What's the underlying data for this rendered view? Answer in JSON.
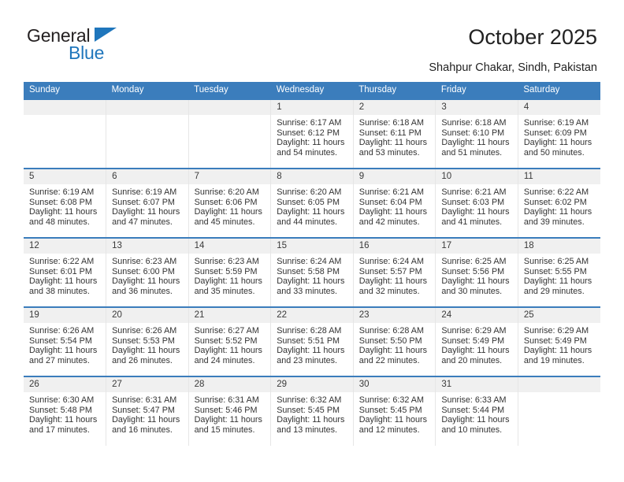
{
  "brand": {
    "name_top": "General",
    "name_bottom": "Blue",
    "accent_color": "#1f76bc"
  },
  "header": {
    "title": "October 2025",
    "subtitle": "Shahpur Chakar, Sindh, Pakistan",
    "header_bg_color": "#3b7dbc"
  },
  "calendar": {
    "weekday_headers": [
      "Sunday",
      "Monday",
      "Tuesday",
      "Wednesday",
      "Thursday",
      "Friday",
      "Saturday"
    ],
    "labels": {
      "sunrise": "Sunrise:",
      "sunset": "Sunset:",
      "daylight": "Daylight:"
    },
    "weeks": [
      [
        {
          "day": "",
          "sunrise": "",
          "sunset": "",
          "daylight_line1": "",
          "daylight_line2": ""
        },
        {
          "day": "",
          "sunrise": "",
          "sunset": "",
          "daylight_line1": "",
          "daylight_line2": ""
        },
        {
          "day": "",
          "sunrise": "",
          "sunset": "",
          "daylight_line1": "",
          "daylight_line2": ""
        },
        {
          "day": "1",
          "sunrise": "Sunrise: 6:17 AM",
          "sunset": "Sunset: 6:12 PM",
          "daylight_line1": "Daylight: 11 hours",
          "daylight_line2": "and 54 minutes."
        },
        {
          "day": "2",
          "sunrise": "Sunrise: 6:18 AM",
          "sunset": "Sunset: 6:11 PM",
          "daylight_line1": "Daylight: 11 hours",
          "daylight_line2": "and 53 minutes."
        },
        {
          "day": "3",
          "sunrise": "Sunrise: 6:18 AM",
          "sunset": "Sunset: 6:10 PM",
          "daylight_line1": "Daylight: 11 hours",
          "daylight_line2": "and 51 minutes."
        },
        {
          "day": "4",
          "sunrise": "Sunrise: 6:19 AM",
          "sunset": "Sunset: 6:09 PM",
          "daylight_line1": "Daylight: 11 hours",
          "daylight_line2": "and 50 minutes."
        }
      ],
      [
        {
          "day": "5",
          "sunrise": "Sunrise: 6:19 AM",
          "sunset": "Sunset: 6:08 PM",
          "daylight_line1": "Daylight: 11 hours",
          "daylight_line2": "and 48 minutes."
        },
        {
          "day": "6",
          "sunrise": "Sunrise: 6:19 AM",
          "sunset": "Sunset: 6:07 PM",
          "daylight_line1": "Daylight: 11 hours",
          "daylight_line2": "and 47 minutes."
        },
        {
          "day": "7",
          "sunrise": "Sunrise: 6:20 AM",
          "sunset": "Sunset: 6:06 PM",
          "daylight_line1": "Daylight: 11 hours",
          "daylight_line2": "and 45 minutes."
        },
        {
          "day": "8",
          "sunrise": "Sunrise: 6:20 AM",
          "sunset": "Sunset: 6:05 PM",
          "daylight_line1": "Daylight: 11 hours",
          "daylight_line2": "and 44 minutes."
        },
        {
          "day": "9",
          "sunrise": "Sunrise: 6:21 AM",
          "sunset": "Sunset: 6:04 PM",
          "daylight_line1": "Daylight: 11 hours",
          "daylight_line2": "and 42 minutes."
        },
        {
          "day": "10",
          "sunrise": "Sunrise: 6:21 AM",
          "sunset": "Sunset: 6:03 PM",
          "daylight_line1": "Daylight: 11 hours",
          "daylight_line2": "and 41 minutes."
        },
        {
          "day": "11",
          "sunrise": "Sunrise: 6:22 AM",
          "sunset": "Sunset: 6:02 PM",
          "daylight_line1": "Daylight: 11 hours",
          "daylight_line2": "and 39 minutes."
        }
      ],
      [
        {
          "day": "12",
          "sunrise": "Sunrise: 6:22 AM",
          "sunset": "Sunset: 6:01 PM",
          "daylight_line1": "Daylight: 11 hours",
          "daylight_line2": "and 38 minutes."
        },
        {
          "day": "13",
          "sunrise": "Sunrise: 6:23 AM",
          "sunset": "Sunset: 6:00 PM",
          "daylight_line1": "Daylight: 11 hours",
          "daylight_line2": "and 36 minutes."
        },
        {
          "day": "14",
          "sunrise": "Sunrise: 6:23 AM",
          "sunset": "Sunset: 5:59 PM",
          "daylight_line1": "Daylight: 11 hours",
          "daylight_line2": "and 35 minutes."
        },
        {
          "day": "15",
          "sunrise": "Sunrise: 6:24 AM",
          "sunset": "Sunset: 5:58 PM",
          "daylight_line1": "Daylight: 11 hours",
          "daylight_line2": "and 33 minutes."
        },
        {
          "day": "16",
          "sunrise": "Sunrise: 6:24 AM",
          "sunset": "Sunset: 5:57 PM",
          "daylight_line1": "Daylight: 11 hours",
          "daylight_line2": "and 32 minutes."
        },
        {
          "day": "17",
          "sunrise": "Sunrise: 6:25 AM",
          "sunset": "Sunset: 5:56 PM",
          "daylight_line1": "Daylight: 11 hours",
          "daylight_line2": "and 30 minutes."
        },
        {
          "day": "18",
          "sunrise": "Sunrise: 6:25 AM",
          "sunset": "Sunset: 5:55 PM",
          "daylight_line1": "Daylight: 11 hours",
          "daylight_line2": "and 29 minutes."
        }
      ],
      [
        {
          "day": "19",
          "sunrise": "Sunrise: 6:26 AM",
          "sunset": "Sunset: 5:54 PM",
          "daylight_line1": "Daylight: 11 hours",
          "daylight_line2": "and 27 minutes."
        },
        {
          "day": "20",
          "sunrise": "Sunrise: 6:26 AM",
          "sunset": "Sunset: 5:53 PM",
          "daylight_line1": "Daylight: 11 hours",
          "daylight_line2": "and 26 minutes."
        },
        {
          "day": "21",
          "sunrise": "Sunrise: 6:27 AM",
          "sunset": "Sunset: 5:52 PM",
          "daylight_line1": "Daylight: 11 hours",
          "daylight_line2": "and 24 minutes."
        },
        {
          "day": "22",
          "sunrise": "Sunrise: 6:28 AM",
          "sunset": "Sunset: 5:51 PM",
          "daylight_line1": "Daylight: 11 hours",
          "daylight_line2": "and 23 minutes."
        },
        {
          "day": "23",
          "sunrise": "Sunrise: 6:28 AM",
          "sunset": "Sunset: 5:50 PM",
          "daylight_line1": "Daylight: 11 hours",
          "daylight_line2": "and 22 minutes."
        },
        {
          "day": "24",
          "sunrise": "Sunrise: 6:29 AM",
          "sunset": "Sunset: 5:49 PM",
          "daylight_line1": "Daylight: 11 hours",
          "daylight_line2": "and 20 minutes."
        },
        {
          "day": "25",
          "sunrise": "Sunrise: 6:29 AM",
          "sunset": "Sunset: 5:49 PM",
          "daylight_line1": "Daylight: 11 hours",
          "daylight_line2": "and 19 minutes."
        }
      ],
      [
        {
          "day": "26",
          "sunrise": "Sunrise: 6:30 AM",
          "sunset": "Sunset: 5:48 PM",
          "daylight_line1": "Daylight: 11 hours",
          "daylight_line2": "and 17 minutes."
        },
        {
          "day": "27",
          "sunrise": "Sunrise: 6:31 AM",
          "sunset": "Sunset: 5:47 PM",
          "daylight_line1": "Daylight: 11 hours",
          "daylight_line2": "and 16 minutes."
        },
        {
          "day": "28",
          "sunrise": "Sunrise: 6:31 AM",
          "sunset": "Sunset: 5:46 PM",
          "daylight_line1": "Daylight: 11 hours",
          "daylight_line2": "and 15 minutes."
        },
        {
          "day": "29",
          "sunrise": "Sunrise: 6:32 AM",
          "sunset": "Sunset: 5:45 PM",
          "daylight_line1": "Daylight: 11 hours",
          "daylight_line2": "and 13 minutes."
        },
        {
          "day": "30",
          "sunrise": "Sunrise: 6:32 AM",
          "sunset": "Sunset: 5:45 PM",
          "daylight_line1": "Daylight: 11 hours",
          "daylight_line2": "and 12 minutes."
        },
        {
          "day": "31",
          "sunrise": "Sunrise: 6:33 AM",
          "sunset": "Sunset: 5:44 PM",
          "daylight_line1": "Daylight: 11 hours",
          "daylight_line2": "and 10 minutes."
        },
        {
          "day": "",
          "sunrise": "",
          "sunset": "",
          "daylight_line1": "",
          "daylight_line2": ""
        }
      ]
    ]
  }
}
